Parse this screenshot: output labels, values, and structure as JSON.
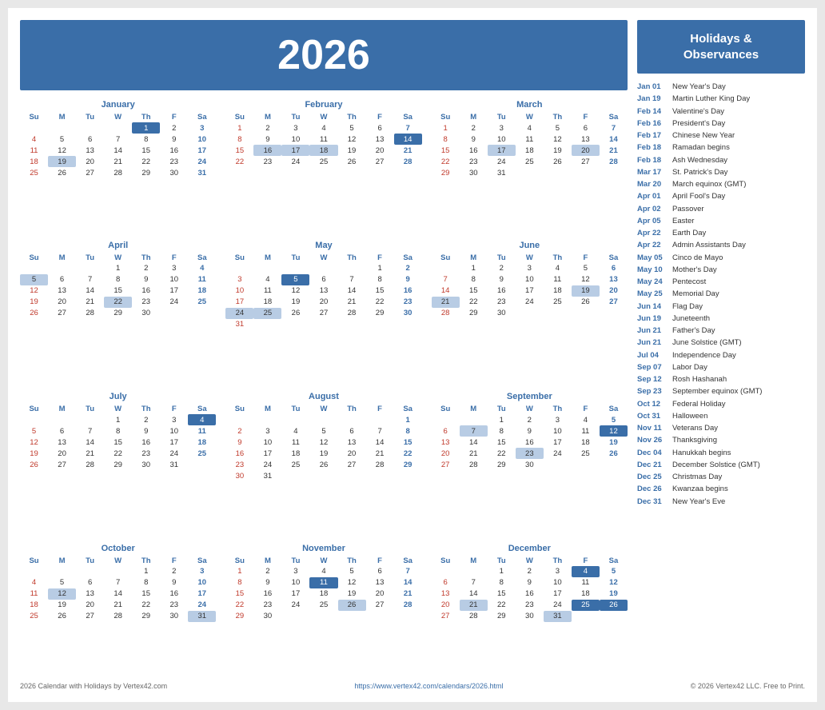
{
  "year": "2026",
  "headerTitle": "Holidays &\nObservances",
  "months": [
    {
      "name": "January",
      "days": [
        [
          "",
          "",
          "",
          "",
          "1",
          "2",
          "3"
        ],
        [
          "4",
          "5",
          "6",
          "7",
          "8",
          "9",
          "10"
        ],
        [
          "11",
          "12",
          "13",
          "14",
          "15",
          "16",
          "17"
        ],
        [
          "18",
          "19",
          "20",
          "21",
          "22",
          "23",
          "24"
        ],
        [
          "25",
          "26",
          "27",
          "28",
          "29",
          "30",
          "31"
        ]
      ],
      "highlights": {
        "blue": [
          "1"
        ],
        "light": [
          "19"
        ]
      }
    },
    {
      "name": "February",
      "days": [
        [
          "1",
          "2",
          "3",
          "4",
          "5",
          "6",
          "7"
        ],
        [
          "8",
          "9",
          "10",
          "11",
          "12",
          "13",
          "14"
        ],
        [
          "15",
          "16",
          "17",
          "18",
          "19",
          "20",
          "21"
        ],
        [
          "22",
          "23",
          "24",
          "25",
          "26",
          "27",
          "28"
        ]
      ],
      "highlights": {
        "blue": [
          "14"
        ],
        "light": [
          "16",
          "17",
          "18"
        ]
      }
    },
    {
      "name": "March",
      "days": [
        [
          "1",
          "2",
          "3",
          "4",
          "5",
          "6",
          "7"
        ],
        [
          "8",
          "9",
          "10",
          "11",
          "12",
          "13",
          "14"
        ],
        [
          "15",
          "16",
          "17",
          "18",
          "19",
          "20",
          "21"
        ],
        [
          "22",
          "23",
          "24",
          "25",
          "26",
          "27",
          "28"
        ],
        [
          "29",
          "30",
          "31",
          "",
          "",
          "",
          ""
        ]
      ],
      "highlights": {
        "blue": [],
        "light": [
          "17",
          "20"
        ]
      }
    },
    {
      "name": "April",
      "days": [
        [
          "",
          "",
          "",
          "1",
          "2",
          "3",
          "4"
        ],
        [
          "5",
          "6",
          "7",
          "8",
          "9",
          "10",
          "11"
        ],
        [
          "12",
          "13",
          "14",
          "15",
          "16",
          "17",
          "18"
        ],
        [
          "19",
          "20",
          "21",
          "22",
          "23",
          "24",
          "25"
        ],
        [
          "26",
          "27",
          "28",
          "29",
          "30",
          "",
          ""
        ]
      ],
      "highlights": {
        "blue": [],
        "light": [
          "5",
          "22"
        ]
      }
    },
    {
      "name": "May",
      "days": [
        [
          "",
          "",
          "",
          "",
          "",
          "1",
          "2"
        ],
        [
          "3",
          "4",
          "5",
          "6",
          "7",
          "8",
          "9"
        ],
        [
          "10",
          "11",
          "12",
          "13",
          "14",
          "15",
          "16"
        ],
        [
          "17",
          "18",
          "19",
          "20",
          "21",
          "22",
          "23"
        ],
        [
          "24",
          "25",
          "26",
          "27",
          "28",
          "29",
          "30"
        ],
        [
          "31",
          "",
          "",
          "",
          "",
          "",
          ""
        ]
      ],
      "highlights": {
        "blue": [
          "5"
        ],
        "light": [
          "24",
          "25"
        ]
      }
    },
    {
      "name": "June",
      "days": [
        [
          "",
          "1",
          "2",
          "3",
          "4",
          "5",
          "6"
        ],
        [
          "7",
          "8",
          "9",
          "10",
          "11",
          "12",
          "13"
        ],
        [
          "14",
          "15",
          "16",
          "17",
          "18",
          "19",
          "20"
        ],
        [
          "21",
          "22",
          "23",
          "24",
          "25",
          "26",
          "27"
        ],
        [
          "28",
          "29",
          "30",
          "",
          "",
          "",
          ""
        ]
      ],
      "highlights": {
        "blue": [],
        "light": [
          "19",
          "21"
        ]
      }
    },
    {
      "name": "July",
      "days": [
        [
          "",
          "",
          "",
          "1",
          "2",
          "3",
          "4"
        ],
        [
          "5",
          "6",
          "7",
          "8",
          "9",
          "10",
          "11"
        ],
        [
          "12",
          "13",
          "14",
          "15",
          "16",
          "17",
          "18"
        ],
        [
          "19",
          "20",
          "21",
          "22",
          "23",
          "24",
          "25"
        ],
        [
          "26",
          "27",
          "28",
          "29",
          "30",
          "31",
          ""
        ]
      ],
      "highlights": {
        "blue": [
          "4"
        ],
        "light": []
      }
    },
    {
      "name": "August",
      "days": [
        [
          "",
          "",
          "",
          "",
          "",
          "",
          "1"
        ],
        [
          "2",
          "3",
          "4",
          "5",
          "6",
          "7",
          "8"
        ],
        [
          "9",
          "10",
          "11",
          "12",
          "13",
          "14",
          "15"
        ],
        [
          "16",
          "17",
          "18",
          "19",
          "20",
          "21",
          "22"
        ],
        [
          "23",
          "24",
          "25",
          "26",
          "27",
          "28",
          "29"
        ],
        [
          "30",
          "31",
          "",
          "",
          "",
          "",
          ""
        ]
      ],
      "highlights": {
        "blue": [],
        "light": []
      }
    },
    {
      "name": "September",
      "days": [
        [
          "",
          "",
          "1",
          "2",
          "3",
          "4",
          "5"
        ],
        [
          "6",
          "7",
          "8",
          "9",
          "10",
          "11",
          "12"
        ],
        [
          "13",
          "14",
          "15",
          "16",
          "17",
          "18",
          "19"
        ],
        [
          "20",
          "21",
          "22",
          "23",
          "24",
          "25",
          "26"
        ],
        [
          "27",
          "28",
          "29",
          "30",
          "",
          "",
          ""
        ]
      ],
      "highlights": {
        "blue": [
          "12"
        ],
        "light": [
          "7",
          "23"
        ]
      }
    },
    {
      "name": "October",
      "days": [
        [
          "",
          "",
          "",
          "",
          "1",
          "2",
          "3"
        ],
        [
          "4",
          "5",
          "6",
          "7",
          "8",
          "9",
          "10"
        ],
        [
          "11",
          "12",
          "13",
          "14",
          "15",
          "16",
          "17"
        ],
        [
          "18",
          "19",
          "20",
          "21",
          "22",
          "23",
          "24"
        ],
        [
          "25",
          "26",
          "27",
          "28",
          "29",
          "30",
          "31"
        ]
      ],
      "highlights": {
        "blue": [],
        "light": [
          "12",
          "31"
        ]
      }
    },
    {
      "name": "November",
      "days": [
        [
          "1",
          "2",
          "3",
          "4",
          "5",
          "6",
          "7"
        ],
        [
          "8",
          "9",
          "10",
          "11",
          "12",
          "13",
          "14"
        ],
        [
          "15",
          "16",
          "17",
          "18",
          "19",
          "20",
          "21"
        ],
        [
          "22",
          "23",
          "24",
          "25",
          "26",
          "27",
          "28"
        ],
        [
          "29",
          "30",
          "",
          "",
          "",
          "",
          ""
        ]
      ],
      "highlights": {
        "blue": [
          "11"
        ],
        "light": [
          "26"
        ]
      }
    },
    {
      "name": "December",
      "days": [
        [
          "",
          "",
          "1",
          "2",
          "3",
          "4",
          "5"
        ],
        [
          "6",
          "7",
          "8",
          "9",
          "10",
          "11",
          "12"
        ],
        [
          "13",
          "14",
          "15",
          "16",
          "17",
          "18",
          "19"
        ],
        [
          "20",
          "21",
          "22",
          "23",
          "24",
          "25",
          "26"
        ],
        [
          "27",
          "28",
          "29",
          "30",
          "31",
          "",
          ""
        ]
      ],
      "highlights": {
        "blue": [
          "4",
          "25",
          "26"
        ],
        "light": [
          "21",
          "31"
        ]
      }
    }
  ],
  "holidays": [
    {
      "date": "Jan 01",
      "name": "New Year's Day"
    },
    {
      "date": "Jan 19",
      "name": "Martin Luther King Day"
    },
    {
      "date": "Feb 14",
      "name": "Valentine's Day"
    },
    {
      "date": "Feb 16",
      "name": "President's Day"
    },
    {
      "date": "Feb 17",
      "name": "Chinese New Year"
    },
    {
      "date": "Feb 18",
      "name": "Ramadan begins"
    },
    {
      "date": "Feb 18",
      "name": "Ash Wednesday"
    },
    {
      "date": "Mar 17",
      "name": "St. Patrick's Day"
    },
    {
      "date": "Mar 20",
      "name": "March equinox (GMT)"
    },
    {
      "date": "Apr 01",
      "name": "April Fool's Day"
    },
    {
      "date": "Apr 02",
      "name": "Passover"
    },
    {
      "date": "Apr 05",
      "name": "Easter"
    },
    {
      "date": "Apr 22",
      "name": "Earth Day"
    },
    {
      "date": "Apr 22",
      "name": "Admin Assistants Day"
    },
    {
      "date": "May 05",
      "name": "Cinco de Mayo"
    },
    {
      "date": "May 10",
      "name": "Mother's Day"
    },
    {
      "date": "May 24",
      "name": "Pentecost"
    },
    {
      "date": "May 25",
      "name": "Memorial Day"
    },
    {
      "date": "Jun 14",
      "name": "Flag Day"
    },
    {
      "date": "Jun 19",
      "name": "Juneteenth"
    },
    {
      "date": "Jun 21",
      "name": "Father's Day"
    },
    {
      "date": "Jun 21",
      "name": "June Solstice (GMT)"
    },
    {
      "date": "Jul 04",
      "name": "Independence Day"
    },
    {
      "date": "Sep 07",
      "name": "Labor Day"
    },
    {
      "date": "Sep 12",
      "name": "Rosh Hashanah"
    },
    {
      "date": "Sep 23",
      "name": "September equinox (GMT)"
    },
    {
      "date": "Oct 12",
      "name": "Federal Holiday"
    },
    {
      "date": "Oct 31",
      "name": "Halloween"
    },
    {
      "date": "Nov 11",
      "name": "Veterans Day"
    },
    {
      "date": "Nov 26",
      "name": "Thanksgiving"
    },
    {
      "date": "Dec 04",
      "name": "Hanukkah begins"
    },
    {
      "date": "Dec 21",
      "name": "December Solstice (GMT)"
    },
    {
      "date": "Dec 25",
      "name": "Christmas Day"
    },
    {
      "date": "Dec 26",
      "name": "Kwanzaa begins"
    },
    {
      "date": "Dec 31",
      "name": "New Year's Eve"
    }
  ],
  "footer": {
    "left": "2026 Calendar with Holidays by Vertex42.com",
    "center": "https://www.vertex42.com/calendars/2026.html",
    "right": "© 2026 Vertex42 LLC. Free to Print."
  }
}
